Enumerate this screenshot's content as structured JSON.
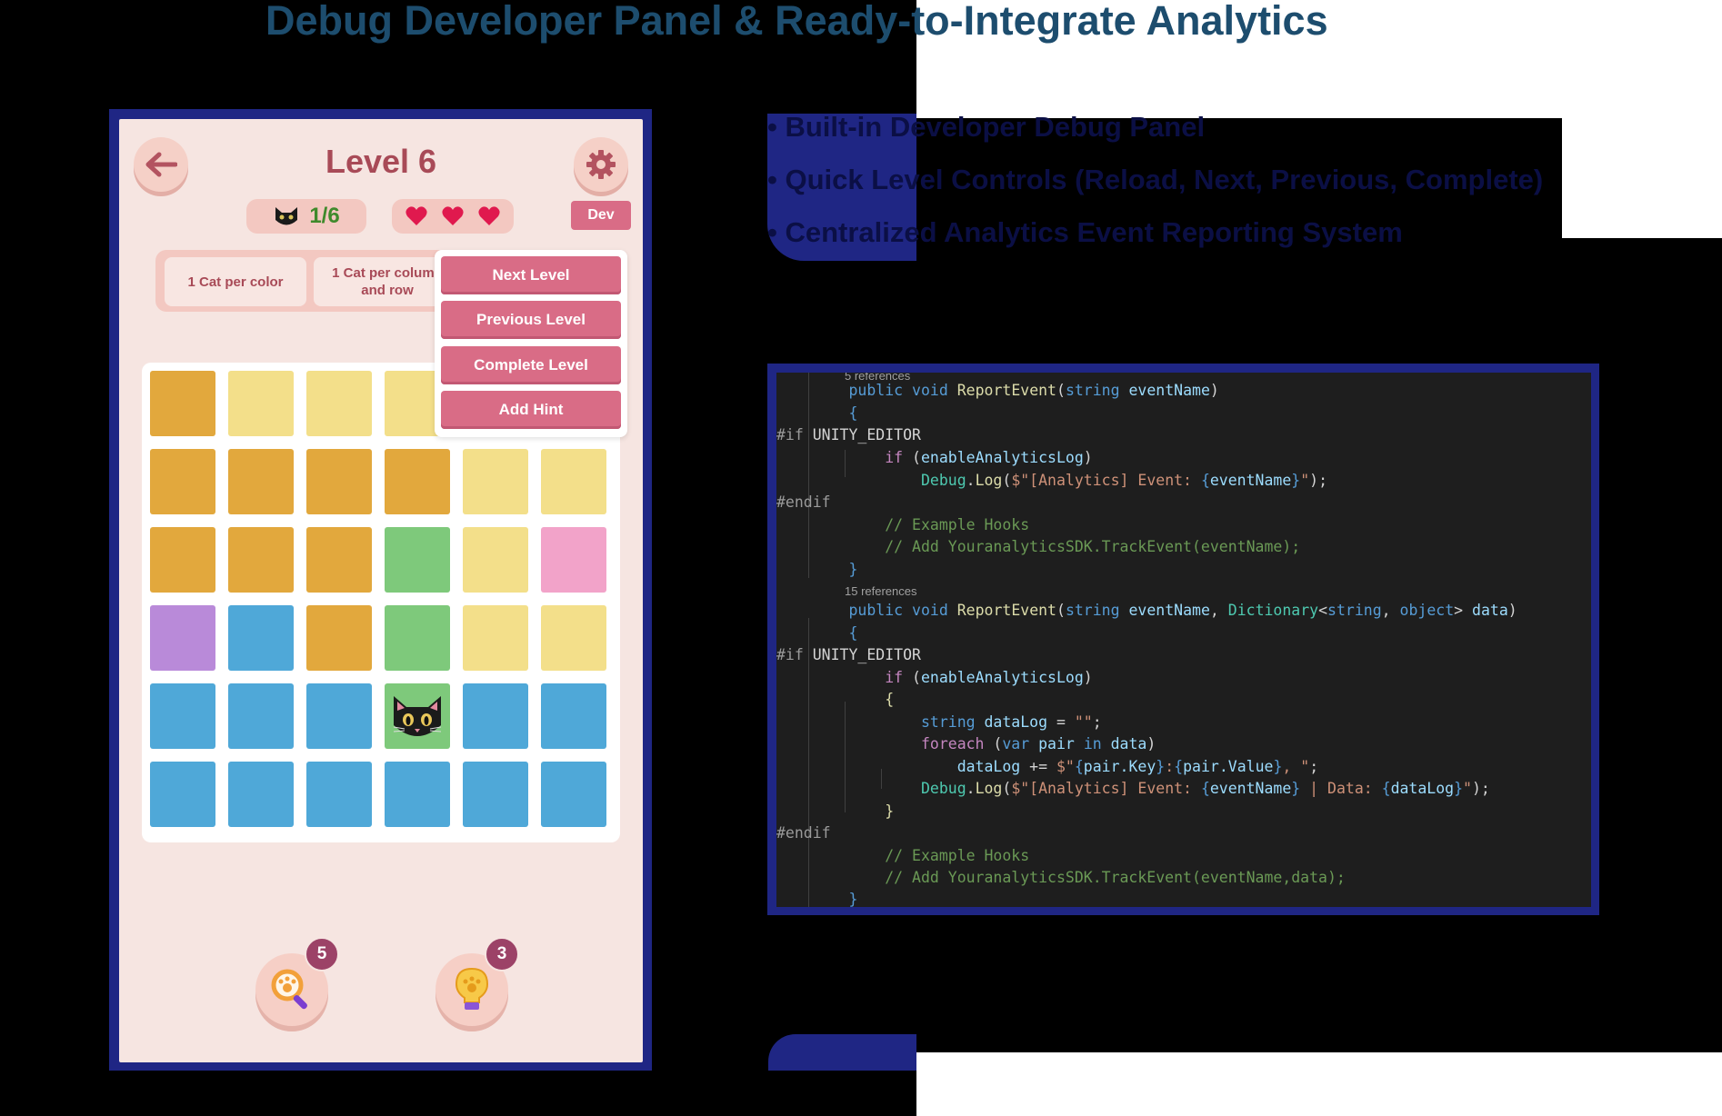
{
  "title": "Debug Developer Panel & Ready-to-Integrate Analytics",
  "colors": {
    "accent_pink": "#d96c86",
    "title_blue": "#1d4d6e",
    "frame_blue": "#1f2684",
    "level_text": "#a84a57"
  },
  "phone": {
    "back_icon": "arrow-left-icon",
    "settings_icon": "gear-icon",
    "level_title": "Level 6",
    "cat_counter": "1/6",
    "lives": 3,
    "dev_button": "Dev",
    "rules": [
      "1 Cat per color",
      "1 Cat per column and row"
    ],
    "dev_menu": [
      "Next Level",
      "Previous Level",
      "Complete Level",
      "Add Hint"
    ],
    "grid": {
      "rows": 6,
      "cols": 6,
      "cells": [
        [
          "orange",
          "yellow",
          "yellow",
          "yellow",
          "yellow",
          "yellow"
        ],
        [
          "orange",
          "orange",
          "orange",
          "orange",
          "yellow",
          "yellow"
        ],
        [
          "orange",
          "orange",
          "orange",
          "green",
          "yellow",
          "pink"
        ],
        [
          "purple",
          "blue",
          "orange",
          "green",
          "yellow",
          "yellow"
        ],
        [
          "blue",
          "blue",
          "blue",
          "green",
          "blue",
          "blue"
        ],
        [
          "blue",
          "blue",
          "blue",
          "blue",
          "blue",
          "blue"
        ]
      ],
      "cat_position": [
        4,
        3
      ]
    },
    "boosters": [
      {
        "icon": "magnifier-paw-icon",
        "count": "5"
      },
      {
        "icon": "lightbulb-paw-icon",
        "count": "3"
      }
    ]
  },
  "features": [
    "• Built-in Developer Debug Panel",
    "• Quick Level Controls (Reload, Next, Previous, Complete)",
    "• Centralized Analytics Event Reporting System"
  ],
  "code": {
    "references_1": "5 references",
    "references_2": "15 references",
    "lines": [
      "        public void ReportEvent(string eventName)",
      "        {",
      "#if UNITY_EDITOR",
      "            if (enableAnalyticsLog)",
      "                Debug.Log($\"[Analytics] Event: {eventName}\");",
      "#endif",
      "            // Example Hooks",
      "            // Add YouranalyticsSDK.TrackEvent(eventName);",
      "        }",
      "        public void ReportEvent(string eventName, Dictionary<string, object> data)",
      "        {",
      "#if UNITY_EDITOR",
      "            if (enableAnalyticsLog)",
      "            {",
      "                string dataLog = \"\";",
      "                foreach (var pair in data)",
      "                    dataLog += $\"{pair.Key}:{pair.Value}, \";",
      "                Debug.Log($\"[Analytics] Event: {eventName} | Data: {dataLog}\");",
      "            }",
      "#endif",
      "            // Example Hooks",
      "            // Add YouranalyticsSDK.TrackEvent(eventName,data);",
      "        }"
    ]
  }
}
